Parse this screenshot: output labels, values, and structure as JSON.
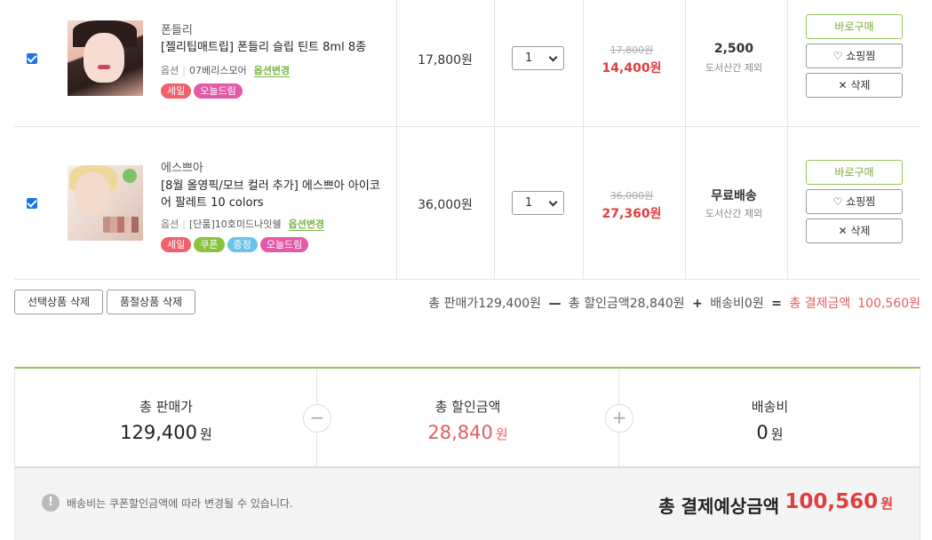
{
  "items": [
    {
      "brand": "폰들리",
      "name": "[젤리팁매트립] 폰들리 슬립 틴트 8ml 8종",
      "option_label": "옵션",
      "option_value": "07베리스모어",
      "option_change": "옵션변경",
      "tags": [
        {
          "label": "세일",
          "color": "#f0616a"
        },
        {
          "label": "오늘드림",
          "color": "#e25aa8"
        }
      ],
      "price": "17,800원",
      "quantity": "1",
      "original_price": "17,800원",
      "sale_price": "14,400원",
      "shipping": "2,500",
      "shipping_note": "도서산간 제외",
      "buy_label": "바로구매",
      "wish_label": "♡ 쇼핑찜",
      "delete_label": "✕ 삭제",
      "checked": true
    },
    {
      "brand": "에스쁘아",
      "name": "[8월 올영픽/모브 컬러 추가] 에스쁘아 아이코어 팔레트 10 colors",
      "option_label": "옵션",
      "option_value": "[단품]10호미드나잇쉘",
      "option_change": "옵션변경",
      "tags": [
        {
          "label": "세일",
          "color": "#f0616a"
        },
        {
          "label": "쿠폰",
          "color": "#8ac43f"
        },
        {
          "label": "증정",
          "color": "#6bc3e8"
        },
        {
          "label": "오늘드림",
          "color": "#e25aa8"
        }
      ],
      "price": "36,000원",
      "quantity": "1",
      "original_price": "36,000원",
      "sale_price": "27,360원",
      "shipping": "무료배송",
      "shipping_note": "도서산간 제외",
      "buy_label": "바로구매",
      "wish_label": "♡ 쇼핑찜",
      "delete_label": "✕ 삭제",
      "checked": true
    }
  ],
  "actions": {
    "delete_selected": "선택상품 삭제",
    "delete_soldout": "품절상품 삭제"
  },
  "summary_line": {
    "sales_text": "총 판매가129,400원",
    "minus": "—",
    "discount_text": "총 할인금액28,840원",
    "plus": "+",
    "ship_text": "배송비0원",
    "equals": "=",
    "total_label": "총 결제금액",
    "total_value": "100,560원"
  },
  "summary": {
    "sales_label": "총 판매가",
    "sales_value": "129,400",
    "discount_label": "총 할인금액",
    "discount_value": "28,840",
    "shipping_label": "배송비",
    "shipping_value": "0",
    "unit": "원",
    "minus_icon": "−",
    "plus_icon": "+",
    "discount_color": "#e55d5d"
  },
  "footer": {
    "notice": "배송비는 쿠폰할인금액에 따라 변경될 수 있습니다.",
    "info_icon": "!",
    "grand_label": "총 결제예상금액",
    "grand_value": "100,560",
    "unit": "원"
  }
}
